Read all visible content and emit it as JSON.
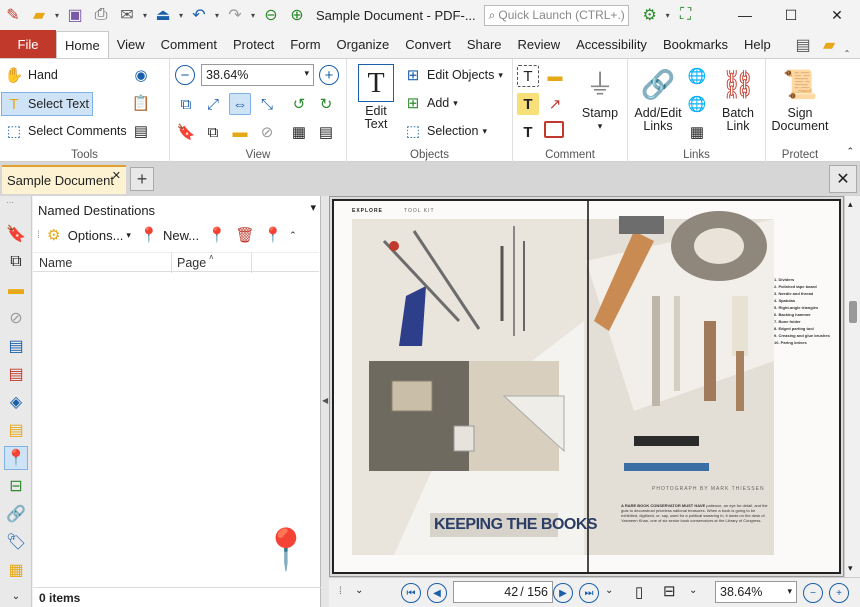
{
  "window": {
    "title": "Sample Document - PDF-...",
    "quick_launch_placeholder": "Quick Launch (CTRL+.)"
  },
  "ribbon_tabs": [
    "File",
    "Home",
    "View",
    "Comment",
    "Protect",
    "Form",
    "Organize",
    "Convert",
    "Share",
    "Review",
    "Accessibility",
    "Bookmarks",
    "Help"
  ],
  "active_tab": "Home",
  "tools_group": {
    "label": "Tools",
    "hand": "Hand",
    "select_text": "Select Text",
    "select_comments": "Select Comments"
  },
  "view_group": {
    "label": "View",
    "zoom_value": "38.64%"
  },
  "objects_group": {
    "label": "Objects",
    "edit_text_line1": "Edit",
    "edit_text_line2": "Text",
    "edit_objects": "Edit Objects",
    "add": "Add",
    "selection": "Selection"
  },
  "comment_group": {
    "label": "Comment",
    "stamp": "Stamp"
  },
  "links_group": {
    "label": "Links",
    "add_edit_line1": "Add/Edit",
    "add_edit_line2": "Links",
    "batch_line1": "Batch",
    "batch_line2": "Link"
  },
  "protect_group": {
    "label": "Protect",
    "sign_line1": "Sign",
    "sign_line2": "Document"
  },
  "doc_tab": {
    "label": "Sample Document"
  },
  "panel": {
    "title": "Named Destinations",
    "options": "Options...",
    "new": "New...",
    "col_name": "Name",
    "col_page": "Page",
    "footer": "0 items"
  },
  "document": {
    "header_left": "EXPLORE",
    "header_right": "TOOL KIT",
    "headline": "KEEPING THE BOOKS",
    "photo_credit": "PHOTOGRAPH BY MARK THIESSEN",
    "intro_lead": "A RARE BOOK CONSERVATOR MUST HAVE",
    "intro_text": "patience, an eye for detail, and the guts to deconstruct priceless national treasures. When a book is going to be exhibited, digitized, or, say, used for a political swearing in, it lands on the desk of Yasmeen Khan, one of six senior book conservators at the Library of Congress.",
    "list_items": [
      "1. Dividers",
      "2. Polished tape board",
      "3. Needle and thread",
      "4. Spatulas",
      "5. Right-angle triangles",
      "6. Backing hammer",
      "7. Bone folder",
      "8. Edged parting tool",
      "9. Creasing and glue brushes",
      "10. Paring knives"
    ]
  },
  "statusbar": {
    "current_page": "42",
    "total_pages": "/ 156",
    "zoom": "38.64%"
  }
}
